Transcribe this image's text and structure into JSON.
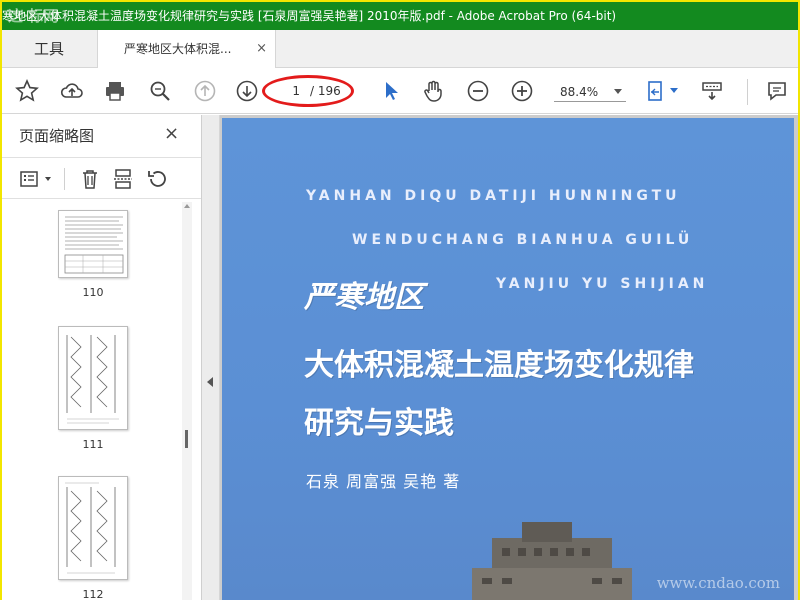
{
  "window": {
    "title": "寒地区大体积混凝土温度场变化规律研究与实践 [石泉周富强吴艳著] 2010年版.pdf - Adobe Acrobat Pro (64-bit)",
    "watermark_top": "这·标网"
  },
  "tabs": {
    "tools_label": "工具",
    "doc_label": "严寒地区大体积混...",
    "doc_close": "×"
  },
  "toolbar": {
    "icons": [
      "star-icon",
      "cloud-upload-icon",
      "print-icon",
      "zoom-search-icon",
      "page-up-icon",
      "page-down-icon",
      "select-cursor-icon",
      "hand-icon",
      "zoom-out-icon",
      "zoom-in-icon",
      "fit-page-icon",
      "scroll-mode-icon",
      "comment-icon"
    ],
    "current_page": "1",
    "total_pages": "/ 196",
    "zoom_level": "88.4%"
  },
  "sidebar": {
    "title": "页面缩略图",
    "close": "×",
    "thumbnails": [
      {
        "page": "110"
      },
      {
        "page": "111"
      },
      {
        "page": "112"
      }
    ]
  },
  "cover": {
    "pinyin_line1": "YANHAN DIQU DATIJI HUNNINGTU",
    "pinyin_line2": "WENDUCHANG BIANHUA GUILÜ",
    "pinyin_line3": "YANJIU YU SHIJIAN",
    "title_line1": "严寒地区",
    "title_line2": "大体积混凝土温度场变化规律",
    "title_line3": "研究与实践",
    "authors": "石泉  周富强  吴艳  著",
    "watermark_bottom": "www.cndao.com"
  },
  "colors": {
    "titlebar": "#138a1f",
    "accent_blue": "#2d6ec9",
    "highlight_oval": "#e31b1b",
    "cover_bg": "#5e94d8"
  }
}
